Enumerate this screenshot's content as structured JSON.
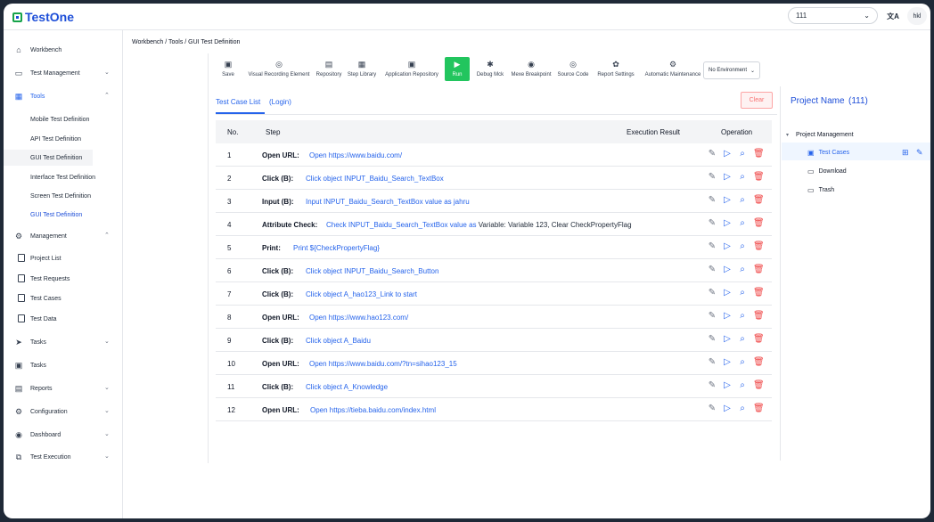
{
  "app": {
    "name": "TestOne"
  },
  "header": {
    "project_select_value": "111",
    "lang_label": "文A",
    "user_label": "hkl"
  },
  "sidebar": {
    "workbench": "Workbench",
    "test_management": "Test Management",
    "tools": "Tools",
    "tools_items": [
      "Mobile Test Definition",
      "API Test Definition",
      "GUI Test Definition",
      "Interface Test Definition",
      "Screen Test Definition",
      "GUI Test Definition"
    ],
    "management": "Management",
    "management_items": [
      "Project List",
      "Test Requests",
      "Test Cases",
      "Test Data"
    ],
    "tasks_group": "Tasks",
    "tasks": "Tasks",
    "reports": "Reports",
    "configuration": "Configuration",
    "dashboard": "Dashboard",
    "test_execution": "Test Execution"
  },
  "breadcrumb": "Workbench  /  Tools  /  GUI Test Definition",
  "toolbar": {
    "save": "Save",
    "visual_recording": "Visual Recording  Element",
    "repository": "Repository",
    "step_library": "Step Library",
    "application_repository": "Application Repository",
    "run": "Run",
    "debug": "Debug Mck",
    "breakpoint": "Mexe  Breakpoint",
    "source_code": "Source Code",
    "report_settings": "Report Settings",
    "automatic_maintenance": "Automatic Maintenance",
    "environment": "No Environment"
  },
  "tabs": {
    "list": "Test Case List",
    "current": "(Login)"
  },
  "clear_label": "Clear",
  "table": {
    "headers": {
      "no": "No.",
      "step": "Step",
      "result": "Execution Result",
      "operation": "Operation"
    },
    "rows": [
      {
        "no": "1",
        "action": "Open URL:",
        "text": "Open https://www.baidu.com/",
        "plain": ""
      },
      {
        "no": "2",
        "action": "Click (B):",
        "text": "Click object INPUT_Baidu_Search_TextBox",
        "plain": ""
      },
      {
        "no": "3",
        "action": "Input (B):",
        "text": "Input INPUT_Baidu_Search_TextBox value as jahru",
        "plain": ""
      },
      {
        "no": "4",
        "action": "Attribute Check:",
        "text": "Check INPUT_Baidu_Search_TextBox value as",
        "plain": " Variable: Variable 123, Clear CheckPropertyFlag"
      },
      {
        "no": "5",
        "action": "Print:",
        "text": "Print ${CheckPropertyFlag}",
        "plain": ""
      },
      {
        "no": "6",
        "action": "Click (B):",
        "text": "Click object INPUT_Baidu_Search_Button",
        "plain": ""
      },
      {
        "no": "7",
        "action": "Click (B):",
        "text": "Click object A_hao123_Link to start",
        "plain": ""
      },
      {
        "no": "8",
        "action": "Open URL:",
        "text": "Open https://www.hao123.com/",
        "plain": ""
      },
      {
        "no": "9",
        "action": "Click (B):",
        "text": "Click object A_Baidu",
        "plain": ""
      },
      {
        "no": "10",
        "action": "Open URL:",
        "text": "Open https://www.baidu.com/?tn=sihao123_15",
        "plain": ""
      },
      {
        "no": "11",
        "action": "Click (B):",
        "text": "Click object A_Knowledge",
        "plain": ""
      },
      {
        "no": "12",
        "action": "Open URL:",
        "text": "Open https://tieba.baidu.com/index.html",
        "plain": ""
      }
    ]
  },
  "right_panel": {
    "title": "Project Name",
    "count": "(111)",
    "root": "Project Management",
    "items": [
      "Test Cases",
      "Download",
      "Trash"
    ]
  },
  "colors": {
    "accent": "#2563eb",
    "run": "#22c55e",
    "danger": "#ef4444"
  }
}
